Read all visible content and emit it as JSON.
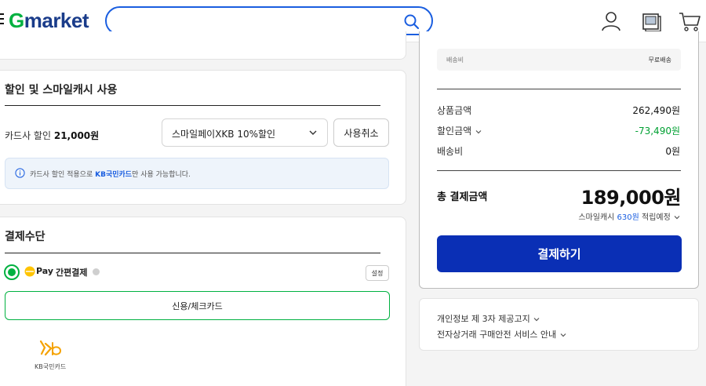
{
  "header": {
    "logo_g": "G",
    "logo_rest": "market",
    "search_placeholder": "",
    "icons": [
      "menu-icon",
      "search-icon",
      "user-icon",
      "recent-items-icon",
      "cart-icon"
    ],
    "brand_color": "#00b140",
    "accent_color": "#1a5ee0"
  },
  "discount": {
    "title": "할인 및 스마일캐시 사용",
    "card_label_prefix": "카드사 할인 ",
    "card_amount": "21,000원",
    "selected_option": "스마일페이XKB 10%할인",
    "cancel_label": "사용취소",
    "info_prefix": "카드사 할인 적용으로 ",
    "info_highlight": "KB국민카드",
    "info_suffix": "만 사용 가능합니다."
  },
  "payment": {
    "title": "결제수단",
    "pay_word": "Pay",
    "pay_label": "간편결제",
    "setting_label": "설정",
    "card_button_label": "신용/체크카드",
    "card_name": "KB국민카드"
  },
  "summary": {
    "shipping_label": "배송비",
    "shipping_value": "무료배송",
    "product_label": "상품금액",
    "product_value": "262,490원",
    "discount_label": "할인금액",
    "discount_value": "-73,490원",
    "delivery_label": "배송비",
    "delivery_value": "0원",
    "total_label": "총 결제금액",
    "total_value": "189,000원",
    "smile_prefix": "스마일캐시 ",
    "smile_points": "630원",
    "smile_suffix": " 적립예정",
    "pay_button": "결제하기",
    "pay_button_color": "#0a2fb5"
  },
  "notices": {
    "privacy": "개인정보 제 3자 제공고지",
    "safety": "전자상거래 구매안전 서비스 안내"
  }
}
